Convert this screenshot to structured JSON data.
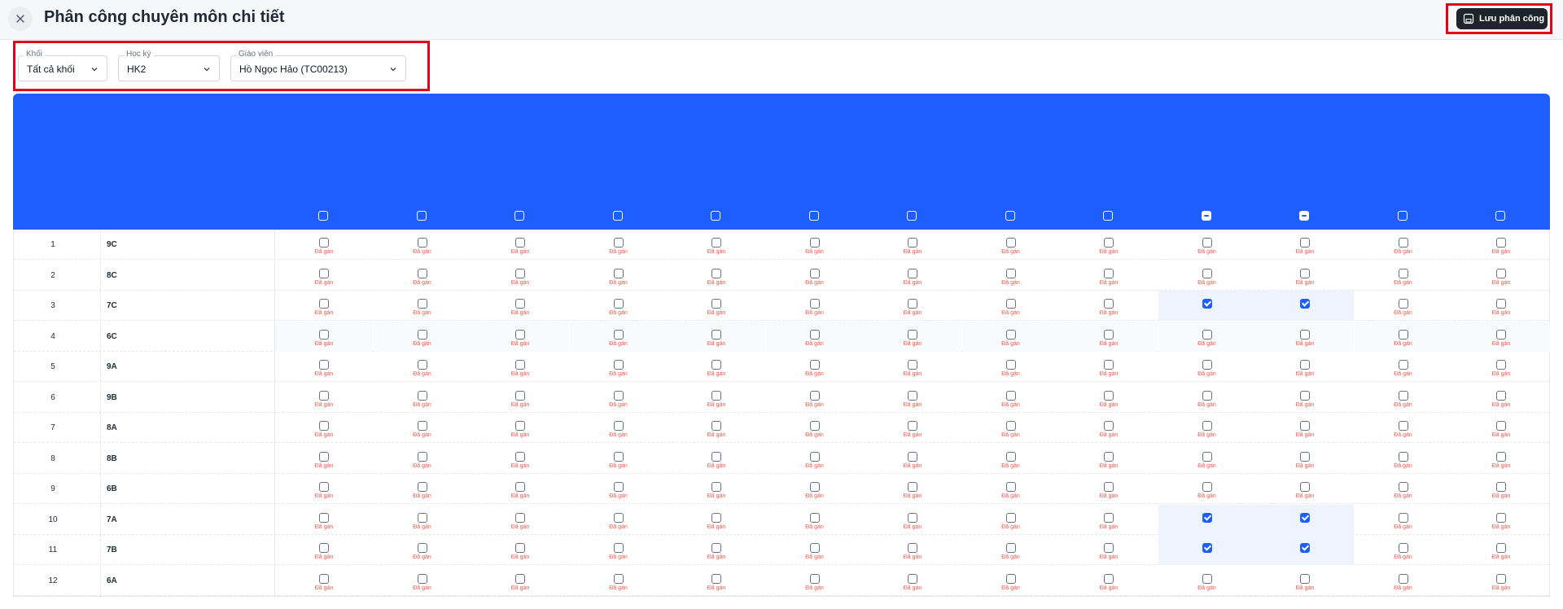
{
  "header": {
    "title": "Phân công chuyên môn chi tiết",
    "save_label": "Lưu phân công"
  },
  "filters": [
    {
      "label": "Khối",
      "value": "Tất cả khối"
    },
    {
      "label": "Học kỳ",
      "value": "HK2"
    },
    {
      "label": "Giáo viên",
      "value": "Hồ Ngọc Hảo (TC00213)"
    }
  ],
  "column_count": 13,
  "header_indeterminate_columns": [
    9,
    10
  ],
  "cell_tag": "Đã gán",
  "rows": [
    {
      "stt": "1",
      "class": "9C",
      "checked": []
    },
    {
      "stt": "2",
      "class": "8C",
      "checked": []
    },
    {
      "stt": "3",
      "class": "7C",
      "checked": [
        9,
        10
      ]
    },
    {
      "stt": "4",
      "class": "6C",
      "checked": []
    },
    {
      "stt": "5",
      "class": "9A",
      "checked": []
    },
    {
      "stt": "6",
      "class": "9B",
      "checked": []
    },
    {
      "stt": "7",
      "class": "8A",
      "checked": []
    },
    {
      "stt": "8",
      "class": "8B",
      "checked": []
    },
    {
      "stt": "9",
      "class": "6B",
      "checked": []
    },
    {
      "stt": "10",
      "class": "7A",
      "checked": [
        9,
        10
      ]
    },
    {
      "stt": "11",
      "class": "7B",
      "checked": [
        9,
        10
      ]
    },
    {
      "stt": "12",
      "class": "6A",
      "checked": []
    }
  ],
  "colors": {
    "header_blue": "#1e5eff",
    "highlight": "#eef4ff",
    "tag_red": "#f2584c",
    "frame_red": "#e3001b"
  }
}
